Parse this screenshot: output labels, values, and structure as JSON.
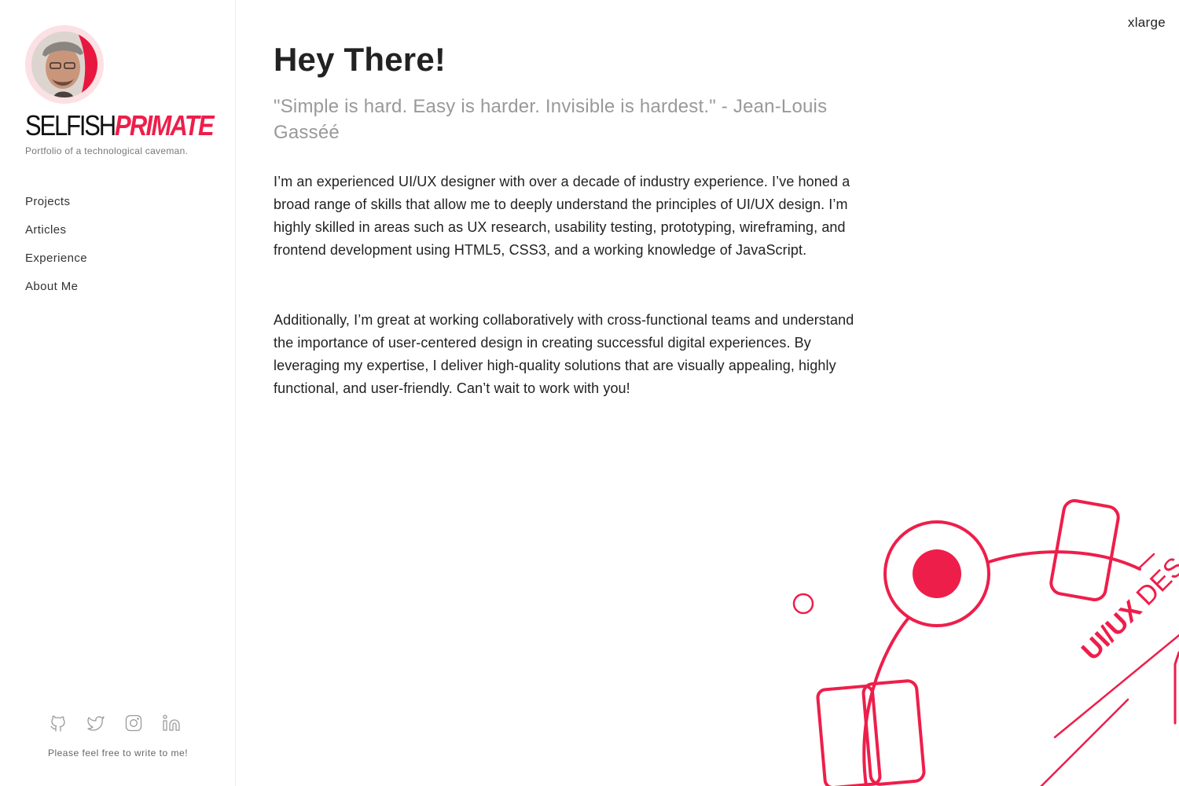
{
  "sidebar": {
    "brand_part1": "SELFISH",
    "brand_part2": "PRIMATE",
    "tagline": "Portfolio of a technological caveman.",
    "nav": [
      {
        "label": "Projects"
      },
      {
        "label": "Articles"
      },
      {
        "label": "Experience"
      },
      {
        "label": "About Me"
      }
    ],
    "social_icons": [
      "github-icon",
      "twitter-icon",
      "instagram-icon",
      "linkedin-icon"
    ],
    "footer_text": "Please feel free to write to me!"
  },
  "main": {
    "size_label": "xlarge",
    "headline": "Hey There!",
    "quote": "\"Simple is hard. Easy is harder. Invisible is hardest.\" - Jean-Louis Gasséé",
    "paragraphs": [
      "I’m an experienced UI/UX designer with over a decade of industry experience. I’ve honed a broad range of skills that allow me to deeply understand the principles of UI/UX design. I’m highly skilled in areas such as UX research, usability testing, prototyping, wireframing, and frontend development using HTML5, CSS3, and a working knowledge of JavaScript.",
      "Additionally, I’m great at working collaboratively with cross-functional teams and understand the importance of user-centered design in creating successful digital experiences. By leveraging my expertise, I deliver high-quality solutions that are visually appealing, highly functional, and user-friendly. Can’t wait to work with you!"
    ],
    "illustration_text_bold": "UI/UX",
    "illustration_text_light": "DES"
  },
  "colors": {
    "accent": "#ee1e4a",
    "text": "#222222",
    "muted": "#999999",
    "border": "#ececec"
  }
}
